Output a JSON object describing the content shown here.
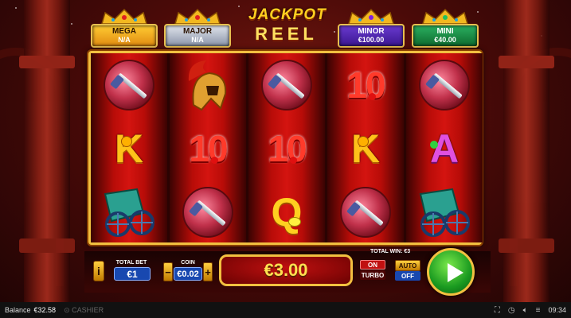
{
  "jackpots": [
    {
      "name": "MEGA",
      "value": "N/A"
    },
    {
      "name": "MAJOR",
      "value": "N/A"
    },
    {
      "name": "MINOR",
      "value": "€100.00"
    },
    {
      "name": "MINI",
      "value": "€40.00"
    }
  ],
  "logo": {
    "line1": "JACKPOT",
    "line2": "REEL"
  },
  "reels": [
    [
      "sword-orb",
      "K",
      "chariot"
    ],
    [
      "gladiator-helmet",
      "10",
      "sword-orb"
    ],
    [
      "sword-orb",
      "10",
      "Q"
    ],
    [
      "10",
      "K",
      "sword-orb"
    ],
    [
      "sword-orb",
      "A",
      "chariot"
    ]
  ],
  "controls": {
    "info_label": "i",
    "total_bet_label": "TOTAL BET",
    "total_bet_value": "€1",
    "coin_label": "COIN",
    "coin_value": "€0.02",
    "minus": "−",
    "plus": "+",
    "win_amount": "€3.00",
    "total_win_label": "TOTAL WIN: €3",
    "turbo_on": "ON",
    "turbo_label": "TURBO",
    "auto_label": "AUTO",
    "auto_state": "OFF"
  },
  "status_bar": {
    "balance_label": "Balance",
    "balance_value": "€32.58",
    "cashier_label": "CASHIER",
    "time": "09:34",
    "icons": [
      "fullscreen-icon",
      "clock-icon",
      "sound-icon",
      "menu-icon"
    ]
  },
  "colors": {
    "frame_gold": "#f2c040",
    "reel_red": "#d41410",
    "spin_green": "#1a9a20",
    "win_yellow": "#ffe050"
  }
}
